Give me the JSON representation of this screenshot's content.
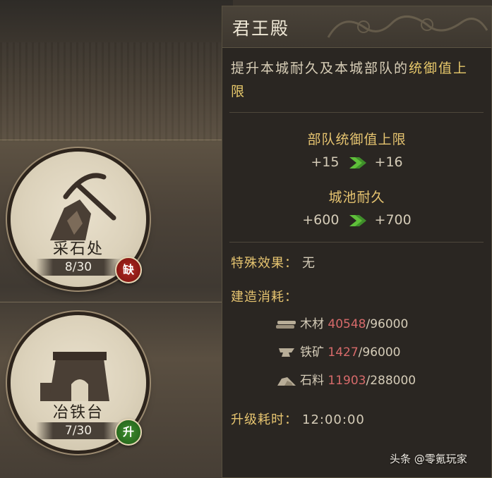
{
  "buildings": [
    {
      "name": "采石处",
      "count": "8/30",
      "badge": "缺",
      "icon": "pickaxe-rock-icon"
    },
    {
      "name": "冶铁台",
      "count": "7/30",
      "badge": "升",
      "icon": "smelter-icon"
    }
  ],
  "panel": {
    "title": "君王殿",
    "desc_before": "提升本城耐久及本城部队的",
    "desc_highlight": "统御值上限",
    "stats": [
      {
        "title": "部队统御值上限",
        "from": "+15",
        "to": "+16"
      },
      {
        "title": "城池耐久",
        "from": "+600",
        "to": "+700"
      }
    ],
    "special_label": "特殊效果：",
    "special_value": "无",
    "cost_label": "建造消耗：",
    "costs": [
      {
        "name": "木材",
        "have": "40548",
        "need": "/96000",
        "icon": "wood-icon"
      },
      {
        "name": "铁矿",
        "have": "1427",
        "need": "/96000",
        "icon": "anvil-icon"
      },
      {
        "name": "石料",
        "have": "11903",
        "need": "/288000",
        "icon": "stone-icon"
      }
    ],
    "time_label": "升级耗时：",
    "time_value": "12:00:00"
  },
  "watermark": "头条 @零氪玩家",
  "colors": {
    "gold": "#e6c470",
    "deficit": "#d66a6a",
    "arrow": "#5fbf3a"
  }
}
